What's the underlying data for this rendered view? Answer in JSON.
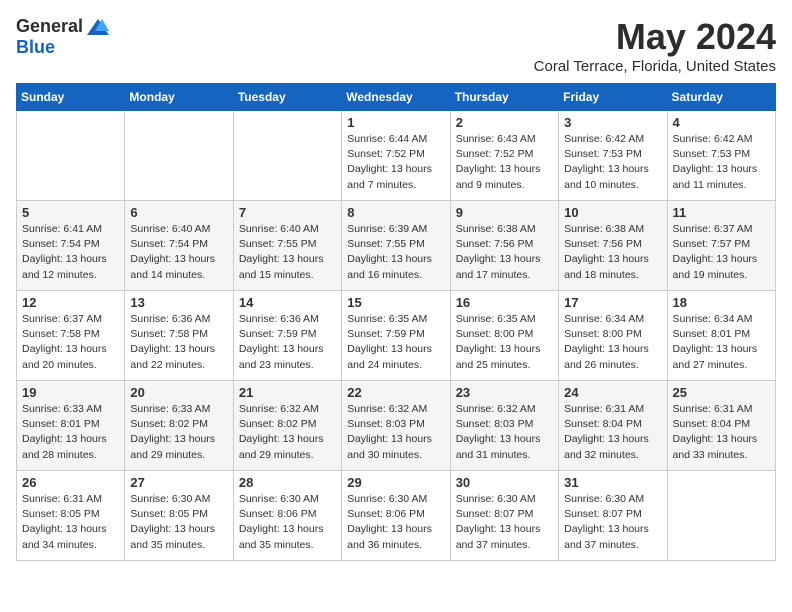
{
  "logo": {
    "general": "General",
    "blue": "Blue"
  },
  "title": "May 2024",
  "location": "Coral Terrace, Florida, United States",
  "days_of_week": [
    "Sunday",
    "Monday",
    "Tuesday",
    "Wednesday",
    "Thursday",
    "Friday",
    "Saturday"
  ],
  "weeks": [
    [
      {
        "day": "",
        "info": ""
      },
      {
        "day": "",
        "info": ""
      },
      {
        "day": "",
        "info": ""
      },
      {
        "day": "1",
        "info": "Sunrise: 6:44 AM\nSunset: 7:52 PM\nDaylight: 13 hours\nand 7 minutes."
      },
      {
        "day": "2",
        "info": "Sunrise: 6:43 AM\nSunset: 7:52 PM\nDaylight: 13 hours\nand 9 minutes."
      },
      {
        "day": "3",
        "info": "Sunrise: 6:42 AM\nSunset: 7:53 PM\nDaylight: 13 hours\nand 10 minutes."
      },
      {
        "day": "4",
        "info": "Sunrise: 6:42 AM\nSunset: 7:53 PM\nDaylight: 13 hours\nand 11 minutes."
      }
    ],
    [
      {
        "day": "5",
        "info": "Sunrise: 6:41 AM\nSunset: 7:54 PM\nDaylight: 13 hours\nand 12 minutes."
      },
      {
        "day": "6",
        "info": "Sunrise: 6:40 AM\nSunset: 7:54 PM\nDaylight: 13 hours\nand 14 minutes."
      },
      {
        "day": "7",
        "info": "Sunrise: 6:40 AM\nSunset: 7:55 PM\nDaylight: 13 hours\nand 15 minutes."
      },
      {
        "day": "8",
        "info": "Sunrise: 6:39 AM\nSunset: 7:55 PM\nDaylight: 13 hours\nand 16 minutes."
      },
      {
        "day": "9",
        "info": "Sunrise: 6:38 AM\nSunset: 7:56 PM\nDaylight: 13 hours\nand 17 minutes."
      },
      {
        "day": "10",
        "info": "Sunrise: 6:38 AM\nSunset: 7:56 PM\nDaylight: 13 hours\nand 18 minutes."
      },
      {
        "day": "11",
        "info": "Sunrise: 6:37 AM\nSunset: 7:57 PM\nDaylight: 13 hours\nand 19 minutes."
      }
    ],
    [
      {
        "day": "12",
        "info": "Sunrise: 6:37 AM\nSunset: 7:58 PM\nDaylight: 13 hours\nand 20 minutes."
      },
      {
        "day": "13",
        "info": "Sunrise: 6:36 AM\nSunset: 7:58 PM\nDaylight: 13 hours\nand 22 minutes."
      },
      {
        "day": "14",
        "info": "Sunrise: 6:36 AM\nSunset: 7:59 PM\nDaylight: 13 hours\nand 23 minutes."
      },
      {
        "day": "15",
        "info": "Sunrise: 6:35 AM\nSunset: 7:59 PM\nDaylight: 13 hours\nand 24 minutes."
      },
      {
        "day": "16",
        "info": "Sunrise: 6:35 AM\nSunset: 8:00 PM\nDaylight: 13 hours\nand 25 minutes."
      },
      {
        "day": "17",
        "info": "Sunrise: 6:34 AM\nSunset: 8:00 PM\nDaylight: 13 hours\nand 26 minutes."
      },
      {
        "day": "18",
        "info": "Sunrise: 6:34 AM\nSunset: 8:01 PM\nDaylight: 13 hours\nand 27 minutes."
      }
    ],
    [
      {
        "day": "19",
        "info": "Sunrise: 6:33 AM\nSunset: 8:01 PM\nDaylight: 13 hours\nand 28 minutes."
      },
      {
        "day": "20",
        "info": "Sunrise: 6:33 AM\nSunset: 8:02 PM\nDaylight: 13 hours\nand 29 minutes."
      },
      {
        "day": "21",
        "info": "Sunrise: 6:32 AM\nSunset: 8:02 PM\nDaylight: 13 hours\nand 29 minutes."
      },
      {
        "day": "22",
        "info": "Sunrise: 6:32 AM\nSunset: 8:03 PM\nDaylight: 13 hours\nand 30 minutes."
      },
      {
        "day": "23",
        "info": "Sunrise: 6:32 AM\nSunset: 8:03 PM\nDaylight: 13 hours\nand 31 minutes."
      },
      {
        "day": "24",
        "info": "Sunrise: 6:31 AM\nSunset: 8:04 PM\nDaylight: 13 hours\nand 32 minutes."
      },
      {
        "day": "25",
        "info": "Sunrise: 6:31 AM\nSunset: 8:04 PM\nDaylight: 13 hours\nand 33 minutes."
      }
    ],
    [
      {
        "day": "26",
        "info": "Sunrise: 6:31 AM\nSunset: 8:05 PM\nDaylight: 13 hours\nand 34 minutes."
      },
      {
        "day": "27",
        "info": "Sunrise: 6:30 AM\nSunset: 8:05 PM\nDaylight: 13 hours\nand 35 minutes."
      },
      {
        "day": "28",
        "info": "Sunrise: 6:30 AM\nSunset: 8:06 PM\nDaylight: 13 hours\nand 35 minutes."
      },
      {
        "day": "29",
        "info": "Sunrise: 6:30 AM\nSunset: 8:06 PM\nDaylight: 13 hours\nand 36 minutes."
      },
      {
        "day": "30",
        "info": "Sunrise: 6:30 AM\nSunset: 8:07 PM\nDaylight: 13 hours\nand 37 minutes."
      },
      {
        "day": "31",
        "info": "Sunrise: 6:30 AM\nSunset: 8:07 PM\nDaylight: 13 hours\nand 37 minutes."
      },
      {
        "day": "",
        "info": ""
      }
    ]
  ]
}
